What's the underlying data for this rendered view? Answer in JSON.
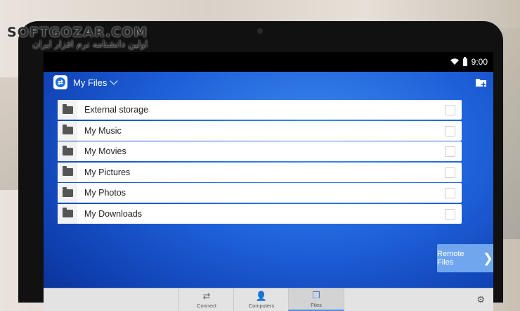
{
  "watermark": {
    "title": "SOFTGOZAR.COM",
    "subtitle": "اولین دانشنامه نرم افزار ایران"
  },
  "statusbar": {
    "time": "9:00"
  },
  "appbar": {
    "title": "My Files"
  },
  "files": [
    {
      "label": "External storage"
    },
    {
      "label": "My Music"
    },
    {
      "label": "My Movies"
    },
    {
      "label": "My Pictures"
    },
    {
      "label": "My Photos"
    },
    {
      "label": "My Downloads"
    }
  ],
  "remote_button": {
    "label": "Remote Files",
    "icon": "chevron-right-icon"
  },
  "tabs": [
    {
      "label": "Connect",
      "icon": "arrows-swap-icon"
    },
    {
      "label": "Computers",
      "icon": "contacts-list-icon"
    },
    {
      "label": "Files",
      "icon": "files-icon"
    }
  ],
  "colors": {
    "screen_blue": "#1e5fd8",
    "accent": "#4a90e2"
  }
}
